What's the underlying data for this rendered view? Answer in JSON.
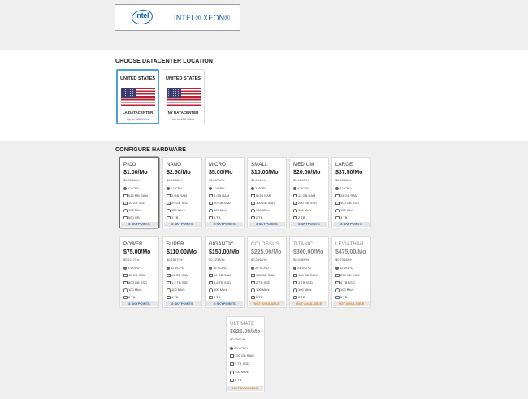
{
  "processor": {
    "brand_logo_text": "intel",
    "label": "INTEL® XEON®"
  },
  "datacenter": {
    "title": "CHOOSE DATACENTER LOCATION",
    "locations": [
      {
        "country": "UNITED STATES",
        "name": "LA DATACENTER",
        "speed": "Up to 500 Mb/s",
        "selected": true
      },
      {
        "country": "UNITED STATES",
        "name": "NY DATACENTER",
        "speed": "Up to 200 Mb/s",
        "selected": false
      }
    ]
  },
  "hardware": {
    "title": "CONFIGURE HARDWARE",
    "plans": [
      {
        "name": "PICO",
        "price": "$1.00/Mo",
        "hourly": "$0.0015/Hr",
        "vcpu": "1 VCPU",
        "ram": "512 MB RAM",
        "ssd": "10 GB SSD",
        "net": "100 Mb/s",
        "bw": "500 GB",
        "footer": "8 SKYPOINTS",
        "available": true,
        "selected": true
      },
      {
        "name": "NANO",
        "price": "$2.50/Mo",
        "hourly": "$0.0038/Hr",
        "vcpu": "1 VCPU",
        "ram": "2 GB RAM",
        "ssd": "20 GB SSD",
        "net": "100 Mb/s",
        "bw": "1 TB",
        "footer": "8 SKYPOINTS",
        "available": true
      },
      {
        "name": "MICRO",
        "price": "$5.00/Mo",
        "hourly": "$0.0075/Hr",
        "vcpu": "1 VCPU",
        "ram": "4 GB RAM",
        "ssd": "60 GB SSD",
        "net": "100 Mb/s",
        "bw": "1 TB",
        "footer": "8 SKYPOINTS",
        "available": true
      },
      {
        "name": "SMALL",
        "price": "$10.00/Mo",
        "hourly": "$0.0149/Hr",
        "vcpu": "2 VCPU",
        "ram": "8 GB RAM",
        "ssd": "100 GB SSD",
        "net": "100 Mb/s",
        "bw": "2 TB",
        "footer": "8 SKYPOINTS",
        "available": true
      },
      {
        "name": "MEDIUM",
        "price": "$20.00/Mo",
        "hourly": "$0.0298/Hr",
        "vcpu": "4 VCPU",
        "ram": "12 GB RAM",
        "ssd": "200 GB SSD",
        "net": "100 Mb/s",
        "bw": "2 TB",
        "footer": "8 SKYPOINTS",
        "available": true
      },
      {
        "name": "LARGE",
        "price": "$37.50/Mo",
        "hourly": "$0.0558/Hr",
        "vcpu": "8 VCPU",
        "ram": "24 GB RAM",
        "ssd": "400 GB SSD",
        "net": "100 Mb/s",
        "bw": "3 TB",
        "footer": "8 SKYPOINTS",
        "available": true
      },
      {
        "name": "POWER",
        "price": "$75.00/Mo",
        "hourly": "$0.1117/Hr",
        "vcpu": "8 VCPU",
        "ram": "48 GB RAM",
        "ssd": "800 GB SSD",
        "net": "100 Mb/s",
        "bw": "3 TB",
        "footer": "8 SKYPOINTS",
        "available": true
      },
      {
        "name": "SUPER",
        "price": "$110.00/Mo",
        "hourly": "$0.1637/Hr",
        "vcpu": "12 VCPU",
        "ram": "64 GB RAM",
        "ssd": "1.2 TB SSD",
        "net": "100 Mb/s",
        "bw": "4 TB",
        "footer": "8 SKYPOINTS",
        "available": true
      },
      {
        "name": "GIGANTIC",
        "price": "$150.00/Mo",
        "hourly": "$0.2233/Hr",
        "vcpu": "16 VCPU",
        "ram": "96 GB RAM",
        "ssd": "1.6 TB SSD",
        "net": "100 Mb/s",
        "bw": "4 TB",
        "footer": "8 SKYPOINTS",
        "available": true
      },
      {
        "name": "COLOSSUS",
        "price": "$225.00/Mo",
        "hourly": "$0.3348/Hr",
        "vcpu": "20 VCPU",
        "ram": "128 GB RAM",
        "ssd": "2 TB SSD",
        "net": "100 Mb/s",
        "bw": "5 TB",
        "footer": "NOT AVAILABLE",
        "available": false
      },
      {
        "name": "TITANIC",
        "price": "$300.00/Mo",
        "hourly": "$0.4465/Hr",
        "vcpu": "24 VCPU",
        "ram": "160 GB RAM",
        "ssd": "3 TB SSD",
        "net": "100 Mb/s",
        "bw": "5 TB",
        "footer": "NOT AVAILABLE",
        "available": false
      },
      {
        "name": "LEVIATHAN",
        "price": "$475.00/Mo",
        "hourly": "$0.7068/Hr",
        "vcpu": "32 VCPU",
        "ram": "256 GB RAM",
        "ssd": "4 TB SSD",
        "net": "100 Mb/s",
        "bw": "6 TB",
        "footer": "NOT AVAILABLE",
        "available": false
      },
      {
        "name": "ULTIMATE",
        "price": "$625.00/Mo",
        "hourly": "$0.9301/Hr",
        "vcpu": "40 VCPU",
        "ram": "320 GB RAM",
        "ssd": "5 TB SSD",
        "net": "100 Mb/s",
        "bw": "6 TB",
        "footer": "NOT AVAILABLE",
        "available": false
      }
    ]
  },
  "colors": {
    "accent_blue": "#2f6db0",
    "unavailable_orange": "#e8891b",
    "selected_border": "#4aa3df"
  }
}
